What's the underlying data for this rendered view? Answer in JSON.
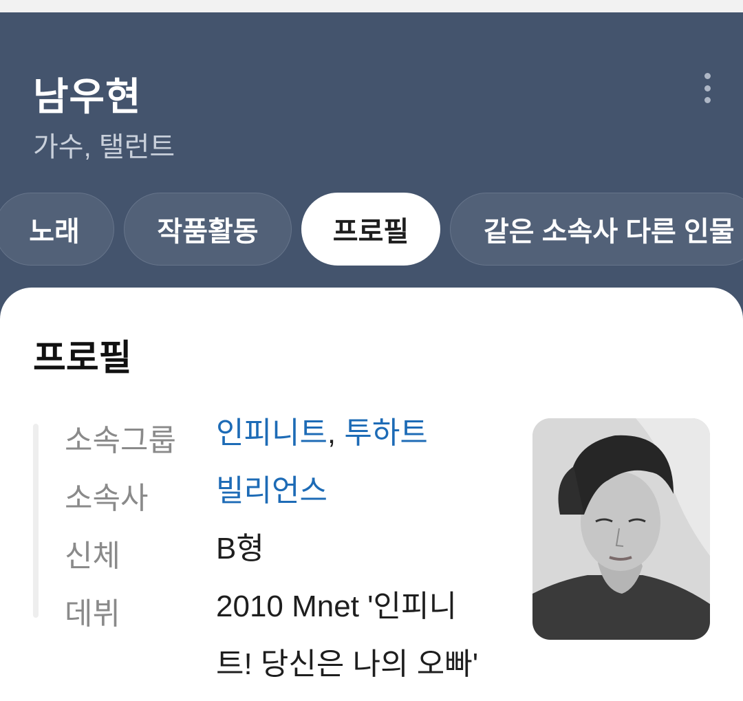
{
  "header": {
    "title": "남우현",
    "subtitle": "가수, 탤런트",
    "more_icon": "more-vert-icon"
  },
  "tabs": [
    {
      "label": "노래",
      "active": false
    },
    {
      "label": "작품활동",
      "active": false
    },
    {
      "label": "프로필",
      "active": true
    },
    {
      "label": "같은 소속사 다른 인물",
      "active": false
    }
  ],
  "profile": {
    "section_title": "프로필",
    "rows": {
      "group": {
        "label": "소속그룹",
        "links": [
          "인피니트",
          "투하트"
        ],
        "separator": ", "
      },
      "agency": {
        "label": "소속사",
        "link": "빌리언스"
      },
      "body": {
        "label": "신체",
        "value": "B형"
      },
      "debut": {
        "label": "데뷔",
        "value_line1": "2010 Mnet '인피니",
        "value_line2": "트! 당신은 나의 오빠'"
      }
    }
  },
  "colors": {
    "header_bg": "#44546d",
    "tab_bg": "#526178",
    "link": "#1d6bb6"
  }
}
